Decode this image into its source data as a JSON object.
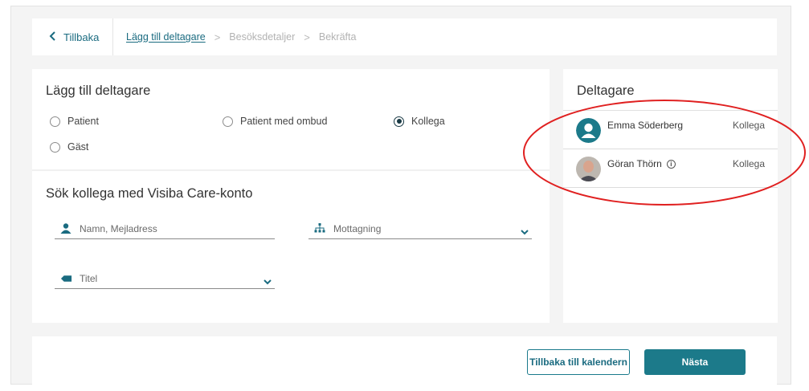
{
  "breadcrumb": {
    "back_label": "Tillbaka",
    "steps": [
      "Lägg till deltagare",
      "Besöksdetaljer",
      "Bekräfta"
    ],
    "separator": ">"
  },
  "participant_type": {
    "title": "Lägg till deltagare",
    "options": [
      "Patient",
      "Patient med ombud",
      "Kollega",
      "Gäst"
    ],
    "selected": "Kollega"
  },
  "search": {
    "title": "Sök kollega med Visiba Care-konto",
    "name_placeholder": "Namn, Mejladress",
    "clinic_placeholder": "Mottagning",
    "title_placeholder": "Titel"
  },
  "participants": {
    "title": "Deltagare",
    "items": [
      {
        "name": "Emma Söderberg",
        "role": "Kollega"
      },
      {
        "name": "Göran Thörn",
        "role": "Kollega"
      }
    ]
  },
  "footer": {
    "back_to_calendar": "Tillbaka till kalendern",
    "next": "Nästa"
  },
  "colors": {
    "accent": "#1c7a8a",
    "annotation": "#e02020"
  }
}
